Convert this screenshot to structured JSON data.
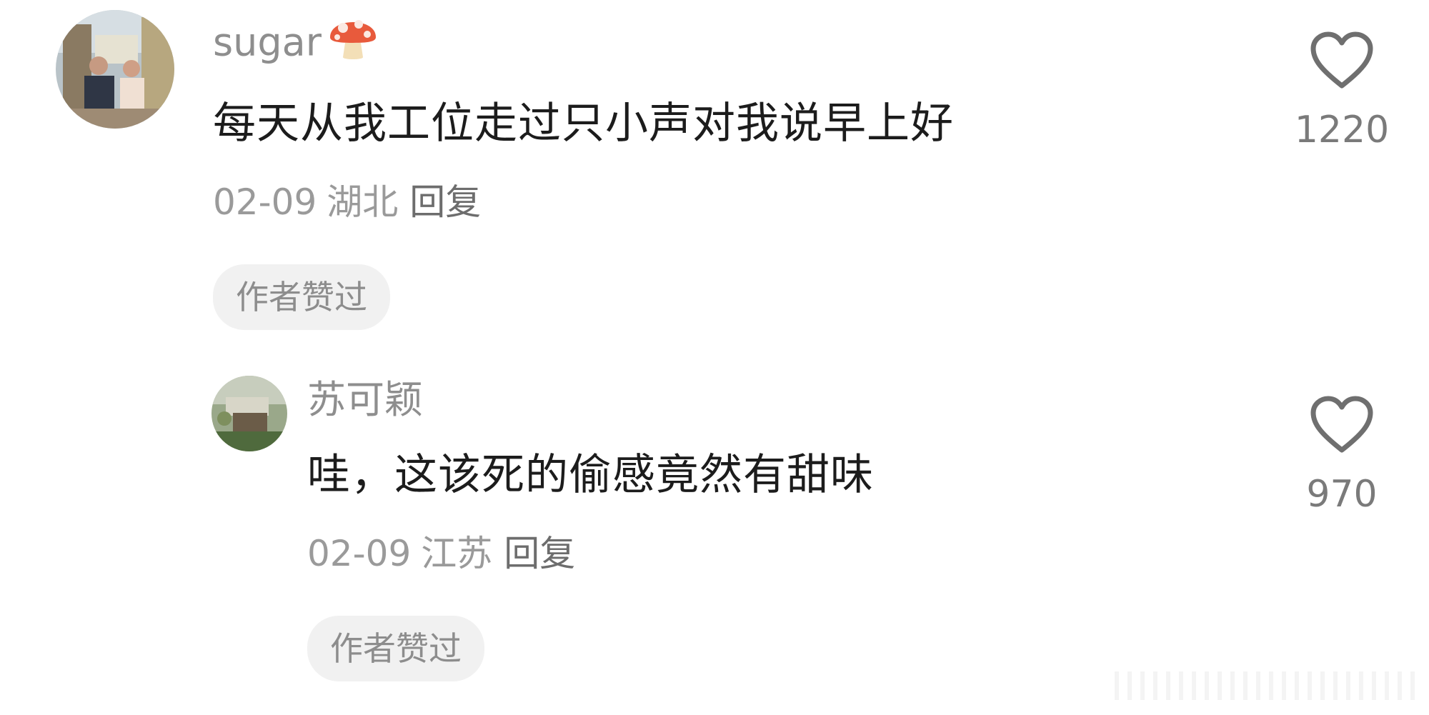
{
  "comments": [
    {
      "username": "sugar",
      "username_emoji": "mushroom-icon",
      "text": "每天从我工位走过只小声对我说早上好",
      "date": "02-09",
      "location": "湖北",
      "reply_label": "回复",
      "badge": "作者赞过",
      "likes": "1220",
      "avatar": "photo-avatar-street"
    },
    {
      "username": "苏可颖",
      "text": "哇，这该死的偷感竟然有甜味",
      "date": "02-09",
      "location": "江苏",
      "reply_label": "回复",
      "badge": "作者赞过",
      "likes": "970",
      "avatar": "photo-avatar-outdoor"
    }
  ],
  "colors": {
    "username": "#8e8e8e",
    "text": "#1c1c1c",
    "meta": "#9a9a9a",
    "badge_bg": "#f1f1f1",
    "heart": "#6f6f6f"
  }
}
